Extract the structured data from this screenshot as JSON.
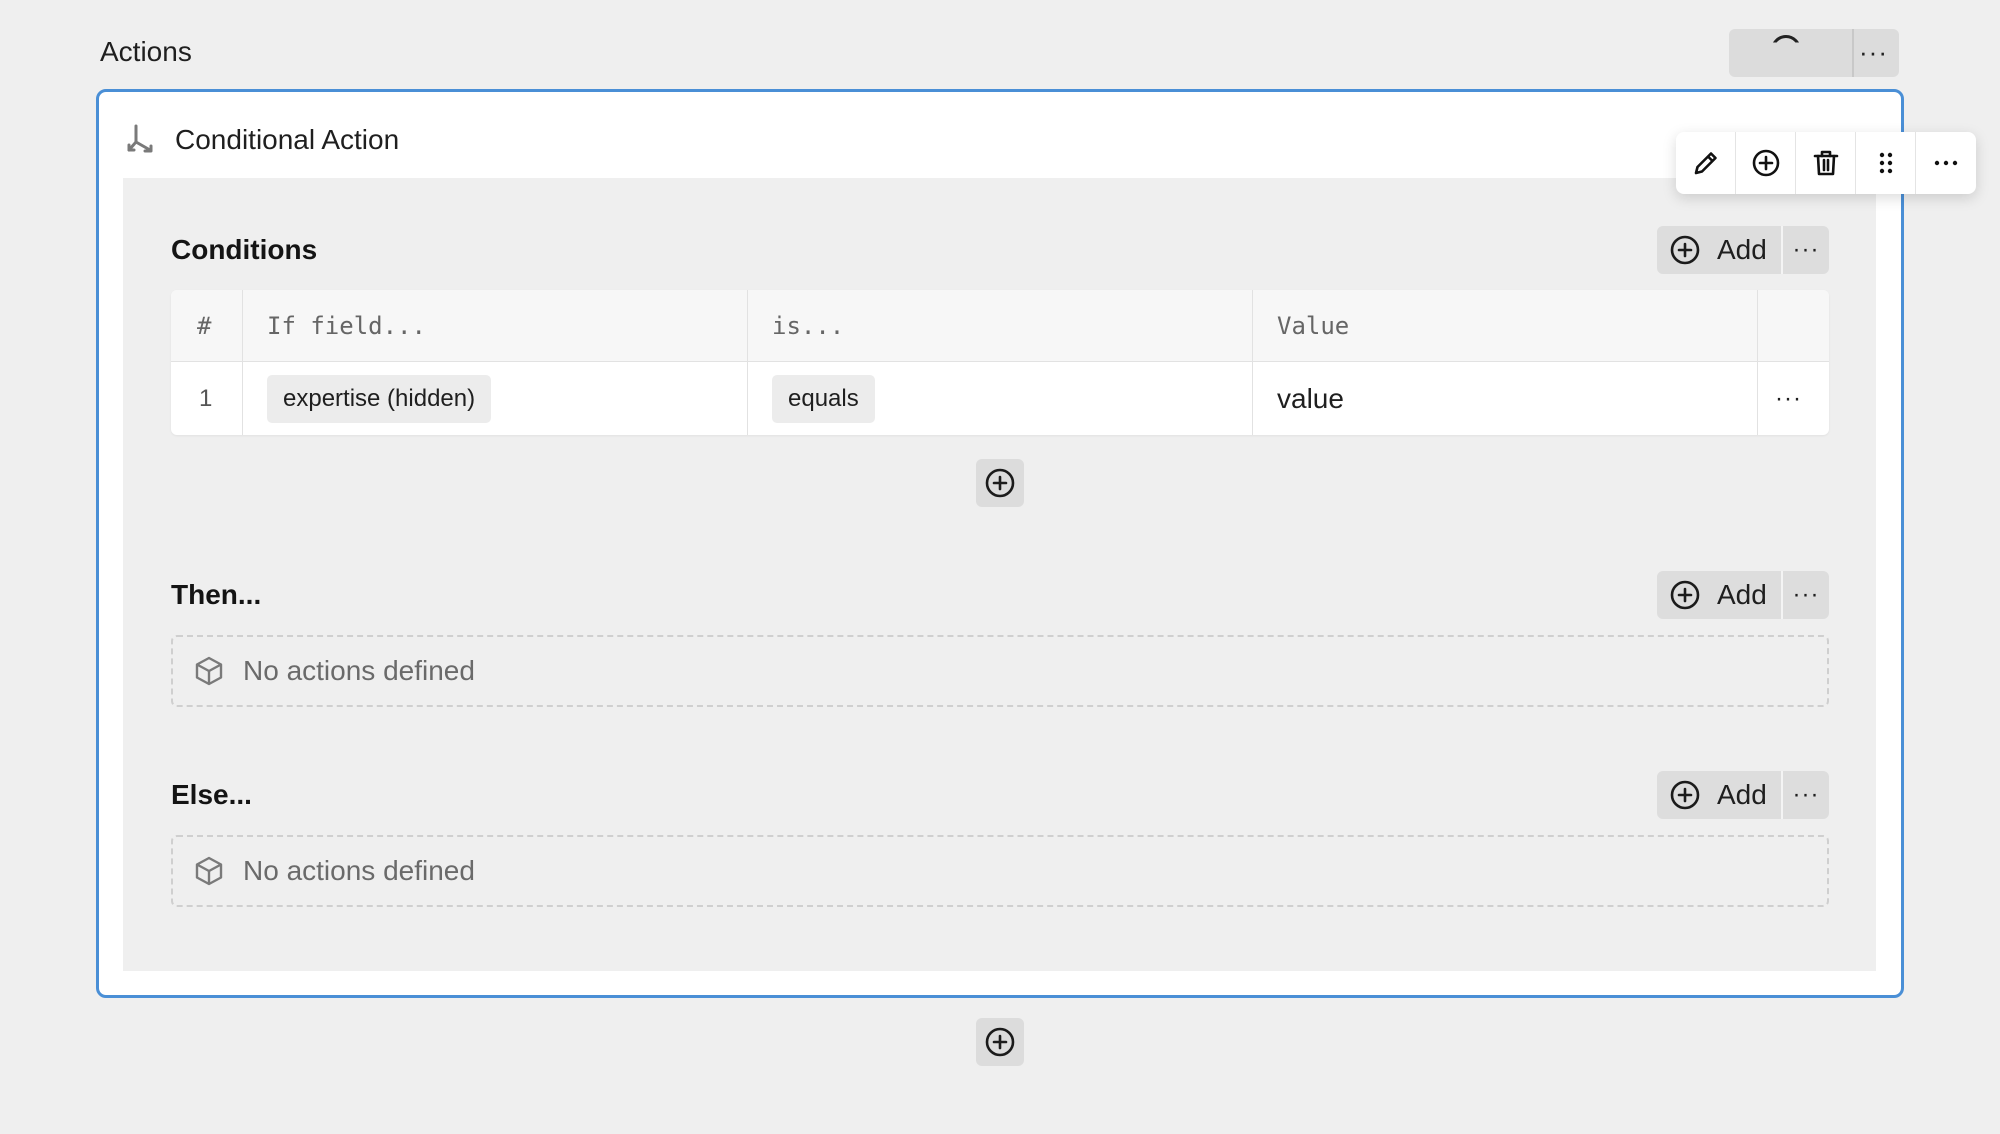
{
  "section": {
    "title": "Actions"
  },
  "card": {
    "title": "Conditional Action"
  },
  "toolbar": {
    "icons": [
      "pencil-icon",
      "plus-circle-icon",
      "trash-icon",
      "drag-handle-icon",
      "more-icon"
    ]
  },
  "conditions": {
    "label": "Conditions",
    "add_label": "Add",
    "more_label": "···",
    "columns": [
      "#",
      "If field...",
      "is...",
      "Value"
    ],
    "rows": [
      {
        "index": "1",
        "field": "expertise (hidden)",
        "operator": "equals",
        "value": "value",
        "more": "···"
      }
    ]
  },
  "then_section": {
    "label": "Then...",
    "add_label": "Add",
    "more_label": "···",
    "empty_text": "No actions defined"
  },
  "else_section": {
    "label": "Else...",
    "add_label": "Add",
    "more_label": "···",
    "empty_text": "No actions defined"
  },
  "colors": {
    "accent_border": "#4a8fd6",
    "background": "#efefef"
  }
}
